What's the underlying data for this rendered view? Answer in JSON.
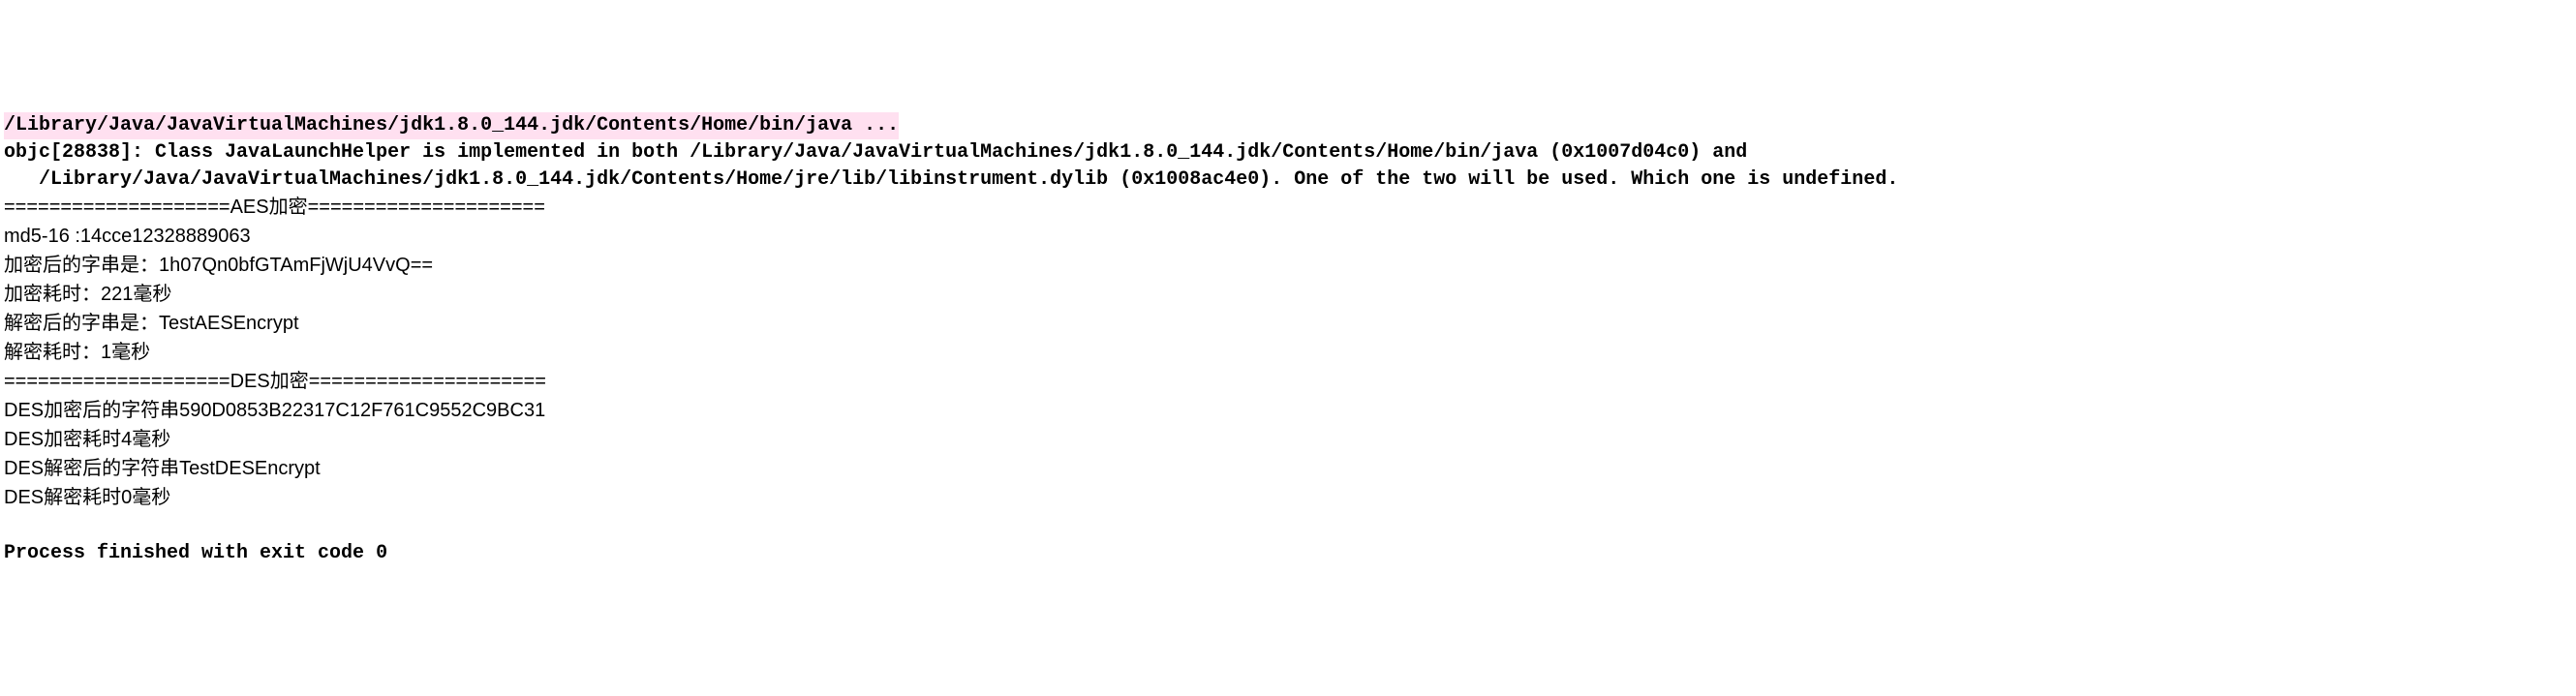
{
  "console": {
    "command_line": "/Library/Java/JavaVirtualMachines/jdk1.8.0_144.jdk/Contents/Home/bin/java ...",
    "objc_line1": "objc[28838]: Class JavaLaunchHelper is implemented in both /Library/Java/JavaVirtualMachines/jdk1.8.0_144.jdk/Contents/Home/bin/java (0x1007d04c0) and",
    "objc_line2": "   /Library/Java/JavaVirtualMachines/jdk1.8.0_144.jdk/Contents/Home/jre/lib/libinstrument.dylib (0x1008ac4e0). One of the two will be used. Which one is undefined.",
    "aes_header": "====================AES加密=====================",
    "md5_line": "md5-16 :14cce12328889063",
    "aes_encrypted": "加密后的字串是：1h07Qn0bfGTAmFjWjU4VvQ==",
    "aes_encrypt_time": "加密耗时：221毫秒",
    "aes_decrypted": "解密后的字串是：TestAESEncrypt",
    "aes_decrypt_time": "解密耗时：1毫秒",
    "des_header": "====================DES加密=====================",
    "des_encrypted": "DES加密后的字符串590D0853B22317C12F761C9552C9BC31",
    "des_encrypt_time": "DES加密耗时4毫秒",
    "des_decrypted": "DES解密后的字符串TestDESEncrypt",
    "des_decrypt_time": "DES解密耗时0毫秒",
    "blank": "",
    "exit_line": "Process finished with exit code 0"
  }
}
